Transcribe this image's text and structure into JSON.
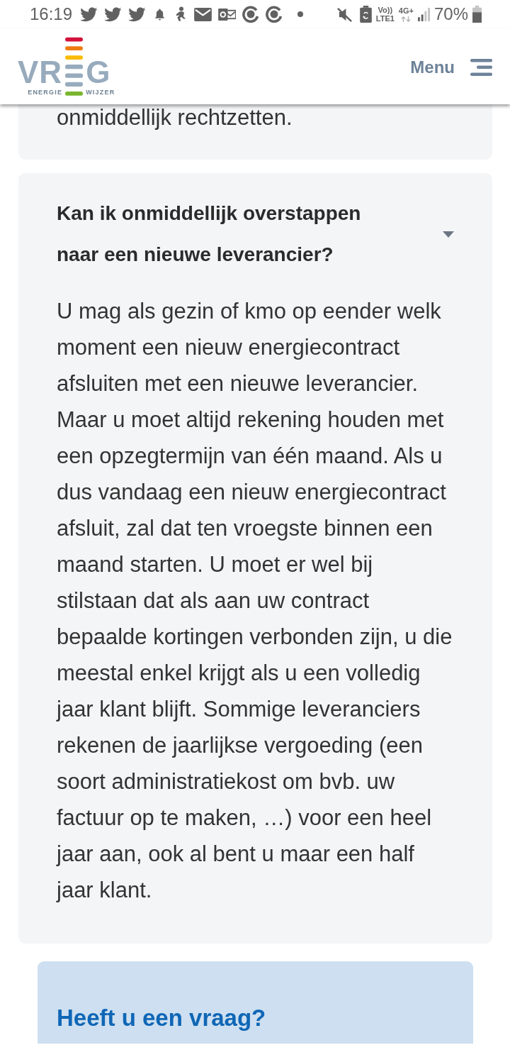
{
  "status_bar": {
    "time": "16:19",
    "voice": "Vo))",
    "lte": "LTE1",
    "network": "4G+",
    "battery": "70%"
  },
  "header": {
    "logo": {
      "letters_left": "VR",
      "letters_right": "G",
      "tagline_left": "ENERGIE",
      "tagline_right": "WIJZER"
    },
    "menu": {
      "label": "Menu"
    }
  },
  "previous_answer": {
    "text": "onmiddellijk rechtzetten."
  },
  "faq_item": {
    "question": "Kan ik onmiddellijk overstappen naar een nieuwe leverancier?",
    "expanded": true,
    "answer": "U mag als gezin of kmo op eender welk moment een nieuw energiecontract afsluiten met een nieuwe leverancier. Maar u moet altijd rekening houden met een opzegtermijn van één maand. Als u dus vandaag een nieuw energiecontract afsluit, zal dat ten vroegste binnen een maand starten. U moet er wel bij stilstaan dat als aan uw contract bepaalde kortingen verbonden zijn, u die meestal enkel krijgt als u een volledig jaar klant blijft. Sommige leveranciers rekenen de jaarlijkse vergoeding (een soort administratiekost om bvb. uw factuur op te maken, …) voor een heel jaar aan, ook al bent u maar een half jaar klant."
  },
  "contact": {
    "title": "Heeft u een vraag?"
  }
}
